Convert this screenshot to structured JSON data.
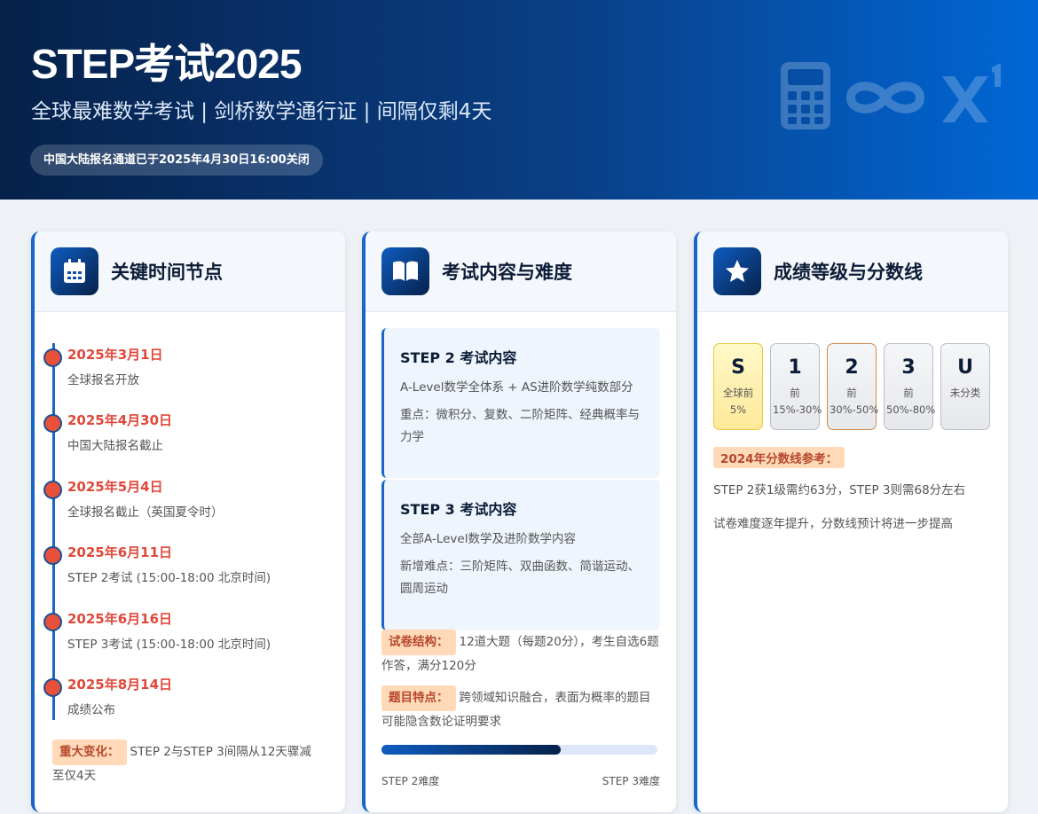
{
  "header": {
    "title": "STEP考试2025",
    "subtitle": "全球最难数学考试 | 剑桥数学通行证 | 间隔仅剩4天",
    "badge": "中国大陆报名通道已于2025年4月30日16:00关闭",
    "decor_icons": [
      "calculator-icon",
      "infinity-icon",
      "superscript-icon"
    ]
  },
  "timeline_card": {
    "title": "关键时间节点",
    "icon": "calendar-icon",
    "items": [
      {
        "date": "2025年3月1日",
        "desc": "全球报名开放"
      },
      {
        "date": "2025年4月30日",
        "desc": "中国大陆报名截止"
      },
      {
        "date": "2025年5月4日",
        "desc": "全球报名截止（英国夏令时）"
      },
      {
        "date": "2025年6月11日",
        "desc": "STEP 2考试 (15:00-18:00 北京时间)"
      },
      {
        "date": "2025年6月16日",
        "desc": "STEP 3考试 (15:00-18:00 北京时间)"
      },
      {
        "date": "2025年8月14日",
        "desc": "成绩公布"
      }
    ],
    "note_tag": "重大变化：",
    "note_text": "STEP 2与STEP 3间隔从12天骤减至仅4天"
  },
  "content_card": {
    "title": "考试内容与难度",
    "icon": "book-icon",
    "step2": {
      "title": "STEP 2 考试内容",
      "line1": "A-Level数学全体系 + AS进阶数学纯数部分",
      "line2": "重点：微积分、复数、二阶矩阵、经典概率与力学"
    },
    "step3": {
      "title": "STEP 3 考试内容",
      "line1": "全部A-Level数学及进阶数学内容",
      "line2": "新增难点：三阶矩阵、双曲函数、简谐运动、圆周运动"
    },
    "structure_tag": "试卷结构：",
    "structure_text": "12道大题（每题20分），考生自选6题作答，满分120分",
    "feature_tag": "题目特点：",
    "feature_text": "跨领域知识融合，表面为概率的题目可能隐含数论证明要求",
    "difficulty_progress": 0.65,
    "bar_left_label": "STEP 2难度",
    "bar_right_label": "STEP 3难度"
  },
  "grade_card": {
    "title": "成绩等级与分数线",
    "icon": "star-icon",
    "grades": [
      {
        "letter": "S",
        "desc": "全球前5%"
      },
      {
        "letter": "1",
        "desc": "前15%-30%"
      },
      {
        "letter": "2",
        "desc": "前30%-50%"
      },
      {
        "letter": "3",
        "desc": "前50%-80%"
      },
      {
        "letter": "U",
        "desc": "未分类"
      }
    ],
    "ref_tag": "2024年分数线参考：",
    "ref_line1": "STEP 2获1级需约63分，STEP 3则需68分左右",
    "ref_line2": "试卷难度逐年提升，分数线预计将进一步提高"
  },
  "colors": {
    "accent_blue": "#1766c8",
    "date_red": "#e0483a",
    "tag_bg": "#ffd9b8",
    "grade_s_bg": "#fff3b0",
    "grade_2_border": "#d9884a"
  }
}
